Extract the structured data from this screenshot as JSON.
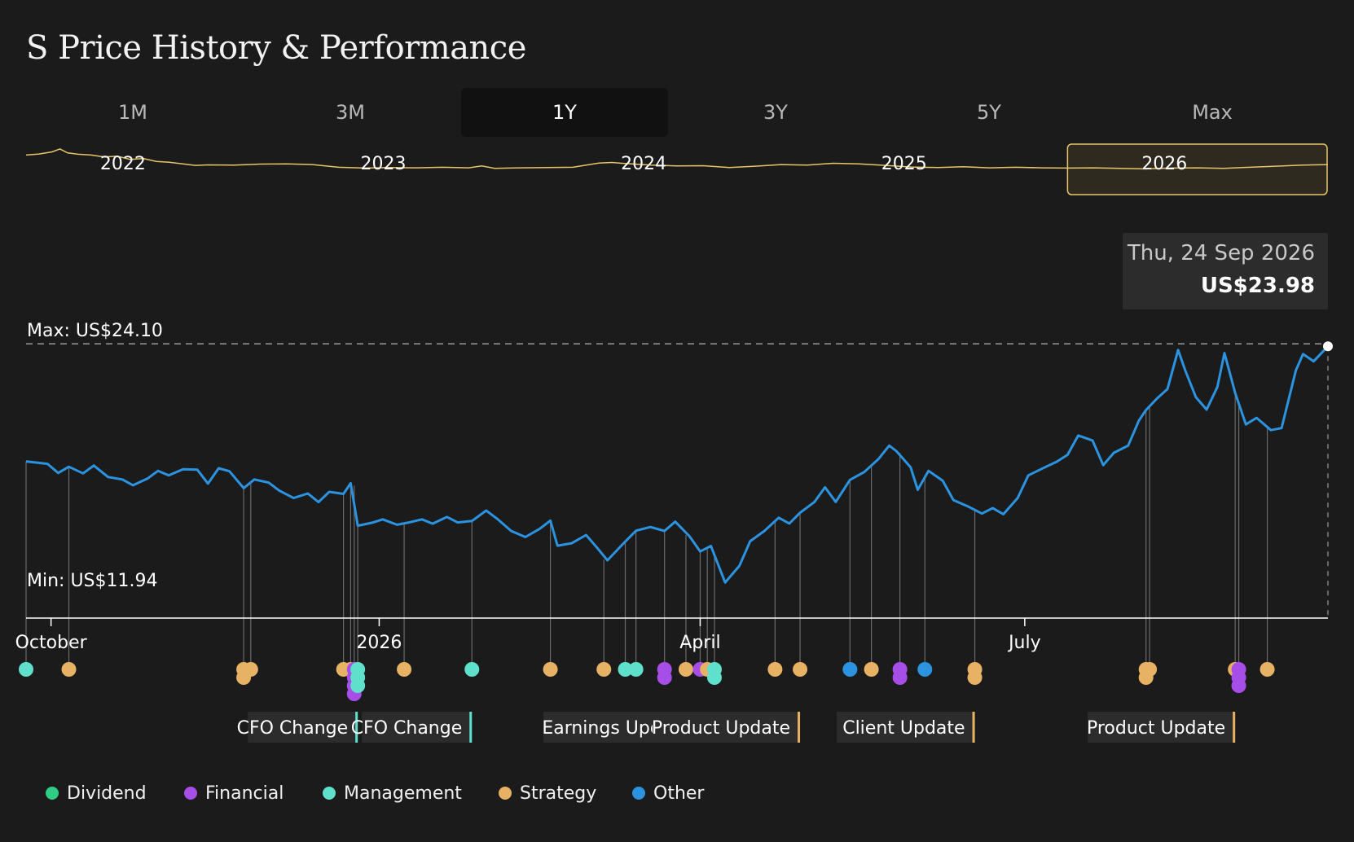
{
  "page_title": "S Price History & Performance",
  "tabs": [
    {
      "label": "1M",
      "active": false
    },
    {
      "label": "3M",
      "active": false
    },
    {
      "label": "1Y",
      "active": true
    },
    {
      "label": "3Y",
      "active": false
    },
    {
      "label": "5Y",
      "active": false
    },
    {
      "label": "Max",
      "active": false
    }
  ],
  "tooltip": {
    "date": "Thu, 24 Sep 2026",
    "price": "US$23.98"
  },
  "colors": {
    "price_line": "#2b93e0",
    "overview_line": "#e9c46a",
    "dividend": "#2ecc84",
    "financial": "#a84ee8",
    "management": "#5fe0cc",
    "strategy": "#e8b264",
    "other": "#2b93e0"
  },
  "legend": [
    {
      "label": "Dividend",
      "key": "dividend"
    },
    {
      "label": "Financial",
      "key": "financial"
    },
    {
      "label": "Management",
      "key": "management"
    },
    {
      "label": "Strategy",
      "key": "strategy"
    },
    {
      "label": "Other",
      "key": "other"
    }
  ],
  "chart_data": [
    {
      "type": "line",
      "name": "overview",
      "x_tick_labels": [
        "2022",
        "2023",
        "2024",
        "2025",
        "2026"
      ],
      "x_ticks": [
        2022.0,
        2023.0,
        2024.0,
        2025.0,
        2026.0
      ],
      "x_range": [
        2021.8,
        2026.8
      ],
      "y_range": [
        11,
        30
      ],
      "selected_range": [
        2025.8,
        2026.8
      ],
      "points": [
        [
          2021.8,
          26.2
        ],
        [
          2021.85,
          26.6
        ],
        [
          2021.9,
          27.4
        ],
        [
          2021.93,
          28.5
        ],
        [
          2021.96,
          27.0
        ],
        [
          2022.0,
          26.5
        ],
        [
          2022.05,
          26.2
        ],
        [
          2022.1,
          25.5
        ],
        [
          2022.15,
          25.8
        ],
        [
          2022.2,
          24.5
        ],
        [
          2022.25,
          24.9
        ],
        [
          2022.3,
          23.8
        ],
        [
          2022.35,
          23.5
        ],
        [
          2022.45,
          22.3
        ],
        [
          2022.5,
          22.5
        ],
        [
          2022.6,
          22.4
        ],
        [
          2022.7,
          22.8
        ],
        [
          2022.8,
          22.9
        ],
        [
          2022.9,
          22.6
        ],
        [
          2023.0,
          21.6
        ],
        [
          2023.1,
          21.3
        ],
        [
          2023.2,
          21.5
        ],
        [
          2023.3,
          21.4
        ],
        [
          2023.4,
          21.6
        ],
        [
          2023.5,
          21.4
        ],
        [
          2023.55,
          22.1
        ],
        [
          2023.6,
          21.2
        ],
        [
          2023.7,
          21.4
        ],
        [
          2023.8,
          21.5
        ],
        [
          2023.9,
          21.6
        ],
        [
          2024.0,
          23.2
        ],
        [
          2024.05,
          23.4
        ],
        [
          2024.1,
          23.0
        ],
        [
          2024.2,
          22.4
        ],
        [
          2024.3,
          22.1
        ],
        [
          2024.4,
          22.2
        ],
        [
          2024.5,
          21.5
        ],
        [
          2024.6,
          22.0
        ],
        [
          2024.7,
          22.6
        ],
        [
          2024.8,
          22.4
        ],
        [
          2024.9,
          23.1
        ],
        [
          2025.0,
          22.9
        ],
        [
          2025.1,
          22.3
        ],
        [
          2025.2,
          21.7
        ],
        [
          2025.3,
          21.5
        ],
        [
          2025.4,
          21.8
        ],
        [
          2025.5,
          21.4
        ],
        [
          2025.6,
          21.6
        ],
        [
          2025.7,
          21.4
        ],
        [
          2025.8,
          21.3
        ],
        [
          2025.9,
          21.4
        ],
        [
          2026.0,
          21.2
        ],
        [
          2026.1,
          21.0
        ],
        [
          2026.2,
          21.3
        ],
        [
          2026.3,
          21.4
        ],
        [
          2026.4,
          21.2
        ],
        [
          2026.5,
          21.6
        ],
        [
          2026.6,
          22.0
        ],
        [
          2026.7,
          22.4
        ],
        [
          2026.8,
          22.6
        ]
      ]
    },
    {
      "type": "line",
      "name": "1Y price",
      "x_tick_labels": [
        "October",
        "2026",
        "April",
        "July"
      ],
      "x_ticks": [
        "2025-10-01",
        "2026-01-01",
        "2026-04-01",
        "2026-07-01"
      ],
      "x_range": [
        "2025-09-24",
        "2026-09-24"
      ],
      "y_range": [
        10.76,
        27.42
      ],
      "annotations": {
        "max_label": "Max: US$24.10",
        "min_label": "Min: US$11.94",
        "max": 24.1,
        "min": 11.94
      },
      "points": [
        [
          "2025-09-24",
          18.38
        ],
        [
          "2025-09-30",
          18.26
        ],
        [
          "2025-10-03",
          17.82
        ],
        [
          "2025-10-06",
          18.12
        ],
        [
          "2025-10-10",
          17.8
        ],
        [
          "2025-10-13",
          18.18
        ],
        [
          "2025-10-17",
          17.62
        ],
        [
          "2025-10-21",
          17.5
        ],
        [
          "2025-10-24",
          17.22
        ],
        [
          "2025-10-28",
          17.54
        ],
        [
          "2025-10-31",
          17.92
        ],
        [
          "2025-11-03",
          17.7
        ],
        [
          "2025-11-07",
          18.0
        ],
        [
          "2025-11-11",
          17.98
        ],
        [
          "2025-11-14",
          17.3
        ],
        [
          "2025-11-17",
          18.05
        ],
        [
          "2025-11-20",
          17.9
        ],
        [
          "2025-11-24",
          17.08
        ],
        [
          "2025-11-27",
          17.5
        ],
        [
          "2025-12-01",
          17.35
        ],
        [
          "2025-12-04",
          16.96
        ],
        [
          "2025-12-08",
          16.6
        ],
        [
          "2025-12-12",
          16.82
        ],
        [
          "2025-12-15",
          16.4
        ],
        [
          "2025-12-18",
          16.9
        ],
        [
          "2025-12-22",
          16.8
        ],
        [
          "2025-12-24",
          17.32
        ],
        [
          "2025-12-26",
          15.25
        ],
        [
          "2025-12-30",
          15.4
        ],
        [
          "2026-01-02",
          15.56
        ],
        [
          "2026-01-06",
          15.3
        ],
        [
          "2026-01-09",
          15.4
        ],
        [
          "2026-01-13",
          15.56
        ],
        [
          "2026-01-16",
          15.35
        ],
        [
          "2026-01-20",
          15.68
        ],
        [
          "2026-01-23",
          15.41
        ],
        [
          "2026-01-27",
          15.48
        ],
        [
          "2026-01-31",
          15.99
        ],
        [
          "2026-02-03",
          15.6
        ],
        [
          "2026-02-07",
          15.0
        ],
        [
          "2026-02-11",
          14.7
        ],
        [
          "2026-02-15",
          15.1
        ],
        [
          "2026-02-18",
          15.5
        ],
        [
          "2026-02-20",
          14.28
        ],
        [
          "2026-02-24",
          14.4
        ],
        [
          "2026-02-28",
          14.8
        ],
        [
          "2026-03-03",
          14.2
        ],
        [
          "2026-03-06",
          13.57
        ],
        [
          "2026-03-10",
          14.3
        ],
        [
          "2026-03-14",
          15.01
        ],
        [
          "2026-03-18",
          15.19
        ],
        [
          "2026-03-22",
          15.0
        ],
        [
          "2026-03-25",
          15.45
        ],
        [
          "2026-03-29",
          14.74
        ],
        [
          "2026-04-01",
          14.0
        ],
        [
          "2026-04-04",
          14.27
        ],
        [
          "2026-04-08",
          12.49
        ],
        [
          "2026-04-12",
          13.3
        ],
        [
          "2026-04-15",
          14.5
        ],
        [
          "2026-04-19",
          15.0
        ],
        [
          "2026-04-23",
          15.64
        ],
        [
          "2026-04-26",
          15.36
        ],
        [
          "2026-04-29",
          15.88
        ],
        [
          "2026-05-03",
          16.4
        ],
        [
          "2026-05-06",
          17.12
        ],
        [
          "2026-05-09",
          16.41
        ],
        [
          "2026-05-13",
          17.48
        ],
        [
          "2026-05-17",
          17.86
        ],
        [
          "2026-05-21",
          18.5
        ],
        [
          "2026-05-24",
          19.15
        ],
        [
          "2026-05-26",
          18.88
        ],
        [
          "2026-05-30",
          18.09
        ],
        [
          "2026-06-01",
          17.0
        ],
        [
          "2026-06-04",
          17.92
        ],
        [
          "2026-06-08",
          17.44
        ],
        [
          "2026-06-11",
          16.5
        ],
        [
          "2026-06-15",
          16.2
        ],
        [
          "2026-06-19",
          15.84
        ],
        [
          "2026-06-22",
          16.11
        ],
        [
          "2026-06-25",
          15.81
        ],
        [
          "2026-06-29",
          16.6
        ],
        [
          "2026-07-02",
          17.7
        ],
        [
          "2026-07-06",
          18.04
        ],
        [
          "2026-07-10",
          18.37
        ],
        [
          "2026-07-13",
          18.7
        ],
        [
          "2026-07-16",
          19.64
        ],
        [
          "2026-07-20",
          19.4
        ],
        [
          "2026-07-23",
          18.2
        ],
        [
          "2026-07-26",
          18.8
        ],
        [
          "2026-07-30",
          19.15
        ],
        [
          "2026-08-02",
          20.37
        ],
        [
          "2026-08-04",
          20.88
        ],
        [
          "2026-08-07",
          21.43
        ],
        [
          "2026-08-10",
          21.9
        ],
        [
          "2026-08-13",
          23.8
        ],
        [
          "2026-08-15",
          22.8
        ],
        [
          "2026-08-18",
          21.5
        ],
        [
          "2026-08-21",
          20.9
        ],
        [
          "2026-08-24",
          22.0
        ],
        [
          "2026-08-26",
          23.65
        ],
        [
          "2026-08-29",
          21.7
        ],
        [
          "2026-09-01",
          20.18
        ],
        [
          "2026-09-04",
          20.5
        ],
        [
          "2026-09-08",
          19.9
        ],
        [
          "2026-09-11",
          20.0
        ],
        [
          "2026-09-15",
          22.8
        ],
        [
          "2026-09-17",
          23.6
        ],
        [
          "2026-09-20",
          23.25
        ],
        [
          "2026-09-24",
          23.98
        ]
      ],
      "events": [
        {
          "date": "2025-09-24",
          "price": 18.38,
          "category": "management",
          "stack": 1
        },
        {
          "date": "2025-10-06",
          "price": 18.12,
          "category": "strategy",
          "stack": 1
        },
        {
          "date": "2025-11-24",
          "price": 17.08,
          "category": "strategy",
          "stack": 2
        },
        {
          "date": "2025-11-26",
          "price": 17.3,
          "category": "strategy",
          "stack": 1
        },
        {
          "date": "2025-12-22",
          "price": 16.8,
          "category": "strategy",
          "stack": 1
        },
        {
          "date": "2025-12-24",
          "price": 17.32,
          "category": "strategy",
          "stack": 1
        },
        {
          "date": "2025-12-25",
          "price": 17.2,
          "category": "financial",
          "stack": 4
        },
        {
          "date": "2025-12-26",
          "price": 15.25,
          "category": "management",
          "stack": 3
        },
        {
          "date": "2026-01-08",
          "price": 15.38,
          "category": "strategy",
          "stack": 1
        },
        {
          "date": "2026-01-27",
          "price": 15.48,
          "category": "management",
          "stack": 1
        },
        {
          "date": "2026-02-18",
          "price": 15.5,
          "category": "strategy",
          "stack": 1
        },
        {
          "date": "2026-03-05",
          "price": 13.6,
          "category": "strategy",
          "stack": 1
        },
        {
          "date": "2026-03-11",
          "price": 14.4,
          "category": "management",
          "stack": 1
        },
        {
          "date": "2026-03-14",
          "price": 15.01,
          "category": "management",
          "stack": 1
        },
        {
          "date": "2026-03-22",
          "price": 15.0,
          "category": "financial",
          "stack": 2
        },
        {
          "date": "2026-03-28",
          "price": 14.8,
          "category": "strategy",
          "stack": 1
        },
        {
          "date": "2026-04-01",
          "price": 14.0,
          "category": "financial",
          "stack": 1
        },
        {
          "date": "2026-04-03",
          "price": 14.2,
          "category": "strategy",
          "stack": 1
        },
        {
          "date": "2026-04-05",
          "price": 13.9,
          "category": "management",
          "stack": 2
        },
        {
          "date": "2026-04-22",
          "price": 15.5,
          "category": "strategy",
          "stack": 1
        },
        {
          "date": "2026-04-29",
          "price": 15.88,
          "category": "strategy",
          "stack": 1
        },
        {
          "date": "2026-05-13",
          "price": 17.48,
          "category": "other",
          "stack": 1
        },
        {
          "date": "2026-05-19",
          "price": 18.2,
          "category": "strategy",
          "stack": 1
        },
        {
          "date": "2026-05-27",
          "price": 18.8,
          "category": "financial",
          "stack": 2
        },
        {
          "date": "2026-06-03",
          "price": 17.7,
          "category": "other",
          "stack": 1
        },
        {
          "date": "2026-06-17",
          "price": 16.0,
          "category": "strategy",
          "stack": 2
        },
        {
          "date": "2026-08-04",
          "price": 20.88,
          "category": "strategy",
          "stack": 2
        },
        {
          "date": "2026-08-05",
          "price": 21.0,
          "category": "strategy",
          "stack": 1
        },
        {
          "date": "2026-08-29",
          "price": 21.7,
          "category": "strategy",
          "stack": 1
        },
        {
          "date": "2026-08-30",
          "price": 21.3,
          "category": "financial",
          "stack": 3
        },
        {
          "date": "2026-09-07",
          "price": 20.0,
          "category": "strategy",
          "stack": 1
        }
      ],
      "event_labels": [
        {
          "label": "CFO Change",
          "date": "2025-12-26",
          "category": "management"
        },
        {
          "label": "CFO Change",
          "date": "2026-01-27",
          "category": "management"
        },
        {
          "label": "Earnings Update",
          "date": "2026-04-01",
          "category": "financial"
        },
        {
          "label": "Product Update",
          "date": "2026-04-29",
          "category": "strategy"
        },
        {
          "label": "Client Update",
          "date": "2026-06-17",
          "category": "strategy"
        },
        {
          "label": "Product Update",
          "date": "2026-08-29",
          "category": "strategy"
        }
      ]
    }
  ]
}
